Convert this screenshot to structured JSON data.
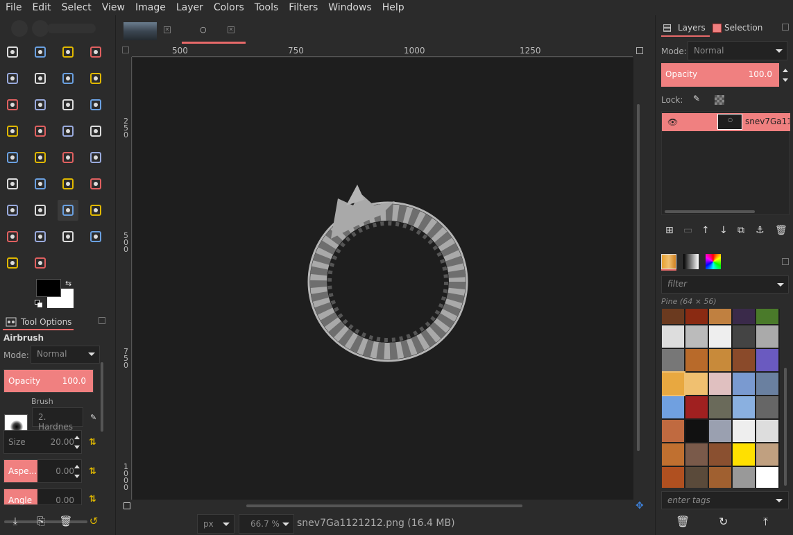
{
  "menubar": [
    "File",
    "Edit",
    "Select",
    "View",
    "Image",
    "Layer",
    "Colors",
    "Tools",
    "Filters",
    "Windows",
    "Help"
  ],
  "toolbox": {
    "tools": [
      "rect-select-icon",
      "ellipse-select-icon",
      "free-select-icon",
      "fuzzy-select-icon",
      "color-select-icon",
      "scissors-select-icon",
      "foreground-select-icon",
      "paths-icon",
      "color-picker-icon",
      "zoom-icon",
      "measure-icon",
      "move-icon",
      "align-icon",
      "crop-icon",
      "unified-transform-icon",
      "scale-icon",
      "perspective-icon",
      "3d-transform-icon",
      "flip-icon",
      "cage-transform-icon",
      "text-icon",
      "bucket-fill-icon",
      "gradient-icon",
      "pencil-icon",
      "paintbrush-icon",
      "eraser-icon",
      "airbrush-icon",
      "ink-icon",
      "clone-icon",
      "heal-icon",
      "perspective-clone-icon",
      "blur-icon",
      "smudge-icon",
      "dodge-burn-icon"
    ],
    "active_tool": "airbrush-icon",
    "foreground_color": "#000000",
    "background_color": "#ffffff"
  },
  "tool_options": {
    "tab_label": "Tool Options",
    "tool_name": "Airbrush",
    "mode_label": "Mode:",
    "mode_value": "Normal",
    "opacity_label": "Opacity",
    "opacity_value": "100.0",
    "brush_label": "Brush",
    "brush_value": "2. Hardnes",
    "size_label": "Size",
    "size_value": "20.00",
    "aspect_label": "Aspe...",
    "aspect_value": "0.00",
    "angle_label": "Angle",
    "angle_value": "0.00"
  },
  "image_tabs": [
    {
      "name": "city-image-tab",
      "active": false
    },
    {
      "name": "ouroboros-image-tab",
      "active": true
    }
  ],
  "ruler_top": [
    "500",
    "750",
    "1000",
    "1250"
  ],
  "ruler_left": [
    "250",
    "500",
    "750",
    "1000"
  ],
  "status": {
    "unit": "px",
    "zoom": "66.7 %",
    "file": "snev7Ga1121212.png (16.4 MB)"
  },
  "layers_panel": {
    "tab_layers": "Layers",
    "tab_selection": "Selection",
    "mode_label": "Mode:",
    "mode_value": "Normal",
    "opacity_label": "Opacity",
    "opacity_value": "100.0",
    "lock_label": "Lock:",
    "layer_name": "snev7Ga11"
  },
  "patterns_panel": {
    "filter_placeholder": "filter",
    "pattern_name": "Pine (64 × 56)",
    "tags_placeholder": "enter tags"
  },
  "colors": {
    "accent": "#f08080",
    "background": "#2b2b2b",
    "canvas": "#1e1e1e",
    "dragon": "#a9a9a9"
  }
}
